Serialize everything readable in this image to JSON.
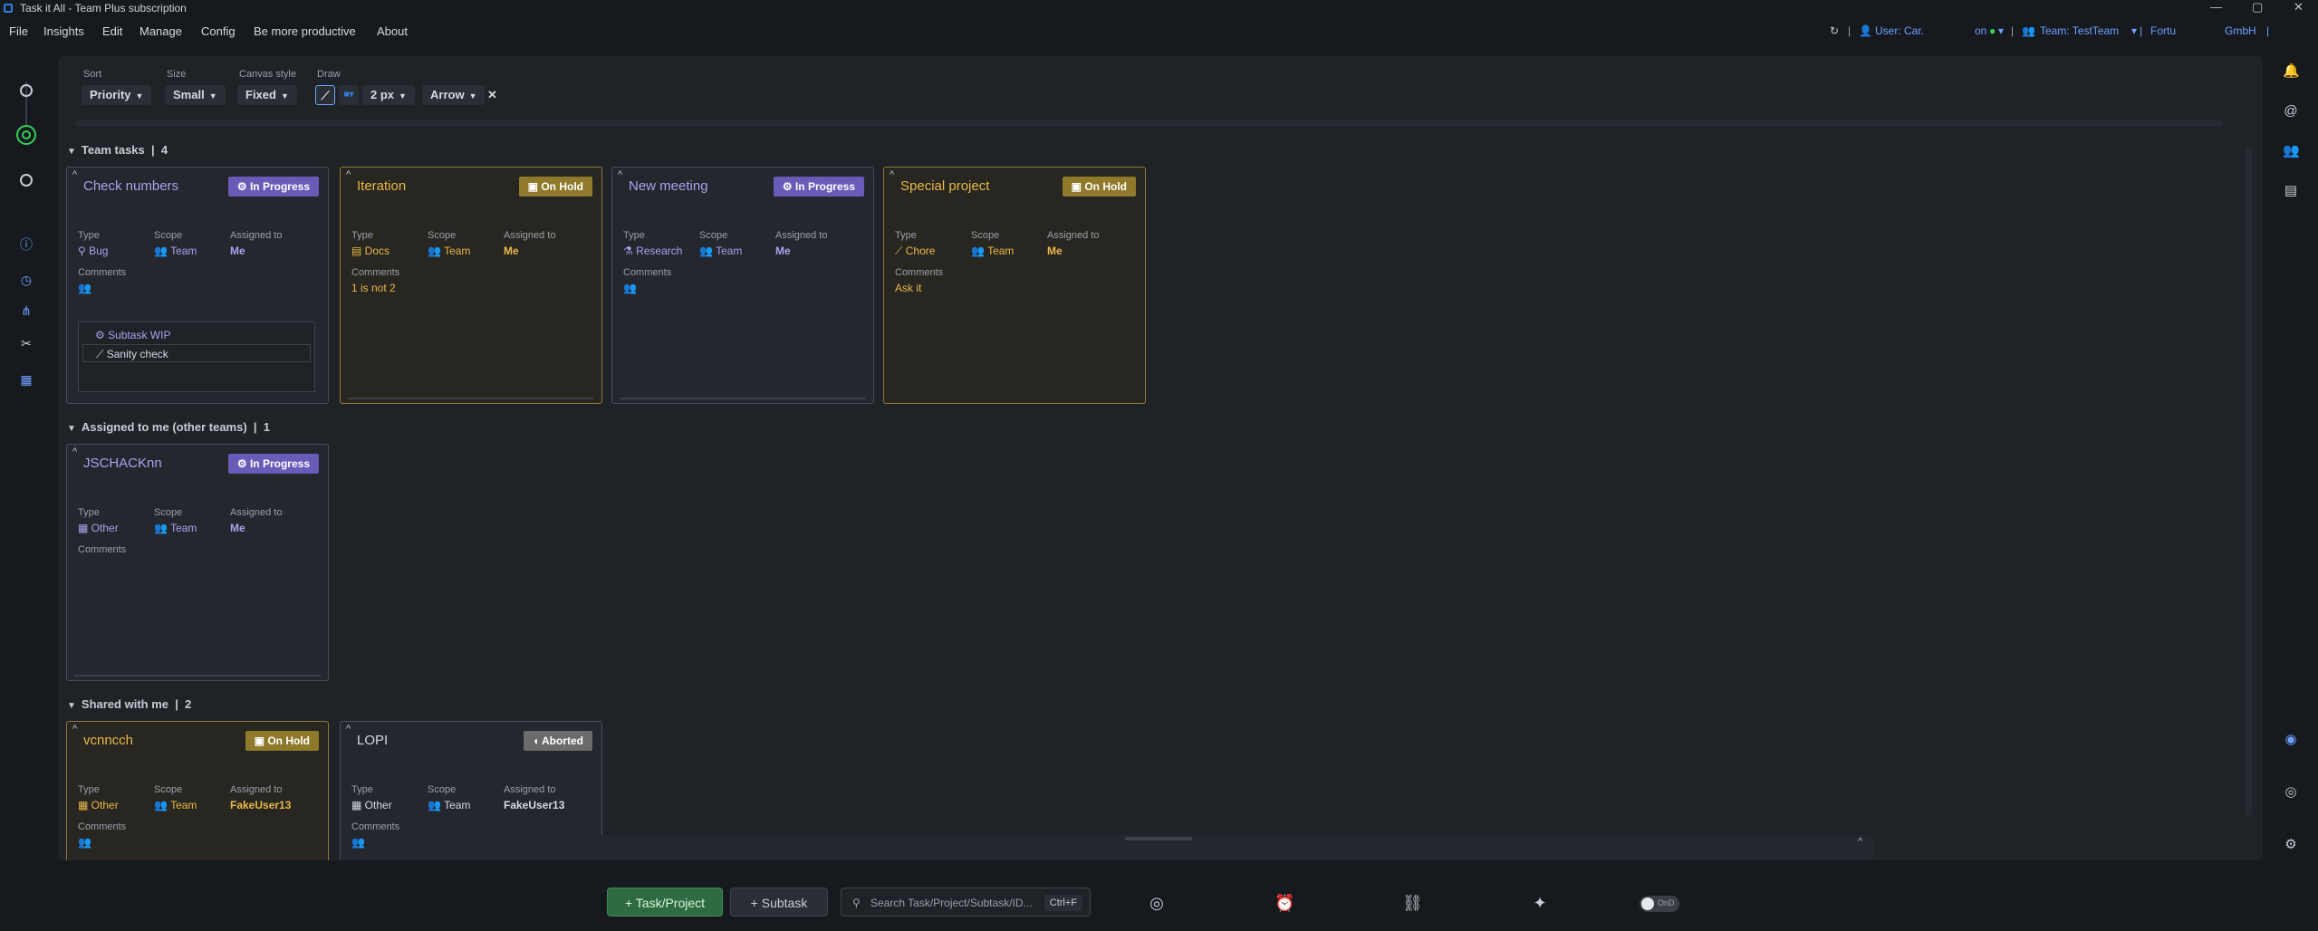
{
  "window": {
    "title": "Task it All - Team Plus subscription"
  },
  "menu": {
    "file": "File",
    "insights": "Insights",
    "edit": "Edit",
    "manage": "Manage",
    "config": "Config",
    "productive": "Be more productive",
    "about": "About"
  },
  "status": {
    "user": "User: Car.",
    "online": "on",
    "team": "Team: TestTeam",
    "company": "Fortu",
    "company2": "GmbH"
  },
  "toolbar": {
    "sort_label": "Sort",
    "sort_value": "Priority",
    "size_label": "Size",
    "size_value": "Small",
    "canvas_label": "Canvas style",
    "canvas_value": "Fixed",
    "draw_label": "Draw",
    "stroke_value": "2 px",
    "shape_value": "Arrow"
  },
  "sections": {
    "team": {
      "title": "Team tasks",
      "count": "4"
    },
    "assigned": {
      "title": "Assigned to me (other teams)",
      "count": "1"
    },
    "shared": {
      "title": "Shared with me",
      "count": "2"
    }
  },
  "labels": {
    "type": "Type",
    "scope": "Scope",
    "assigned": "Assigned to",
    "comments": "Comments"
  },
  "cards": [
    {
      "title": "Check numbers",
      "status": "In Progress",
      "type": "Bug",
      "scope": "Team",
      "assigned": "Me",
      "comments": "",
      "subtasks": [
        "Subtask WIP",
        "Sanity check"
      ]
    },
    {
      "title": "Iteration",
      "status": "On Hold",
      "type": "Docs",
      "scope": "Team",
      "assigned": "Me",
      "comments": "1 is not 2"
    },
    {
      "title": "New meeting",
      "status": "In Progress",
      "type": "Research",
      "scope": "Team",
      "assigned": "Me",
      "comments": ""
    },
    {
      "title": "Special project",
      "status": "On Hold",
      "type": "Chore",
      "scope": "Team",
      "assigned": "Me",
      "comments": "Ask it"
    },
    {
      "title": "JSCHACKnn",
      "status": "In Progress",
      "type": "Other",
      "scope": "Team",
      "assigned": "Me",
      "comments": ""
    },
    {
      "title": "vcnncch",
      "status": "On Hold",
      "type": "Other",
      "scope": "Team",
      "assigned": "FakeUser13",
      "comments": ""
    },
    {
      "title": "LOPI",
      "status": "Aborted",
      "type": "Other",
      "scope": "Team",
      "assigned": "FakeUser13",
      "comments": ""
    }
  ],
  "bottom": {
    "add_task": "+ Task/Project",
    "add_subtask": "+ Subtask",
    "search_placeholder": "Search Task/Project/Subtask/ID...",
    "search_shortcut": "Ctrl+F",
    "toggle_label": "OnD"
  },
  "colors": {
    "in_progress": "#6a5bb8",
    "on_hold": "#8e7a2a",
    "aborted": "#6b6b6b",
    "active_green": "#34d058",
    "accent_blue": "#6ea2ff"
  }
}
